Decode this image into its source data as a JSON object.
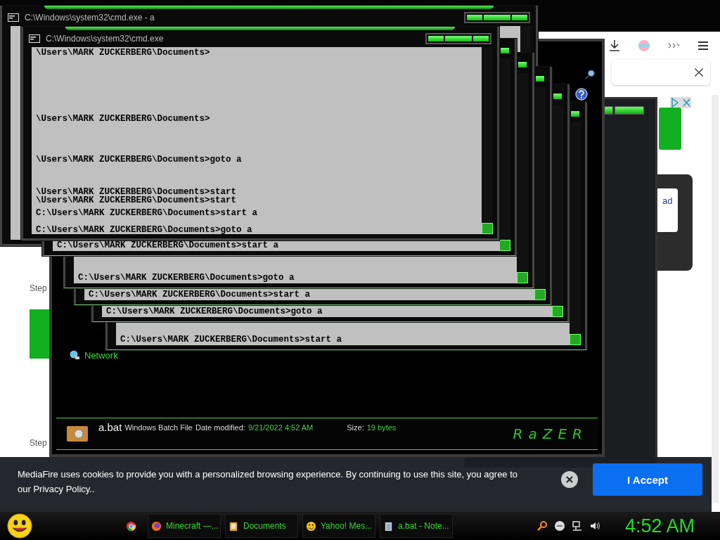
{
  "browser": {
    "ad_link": "ad",
    "steps": [
      "Step",
      "Step"
    ]
  },
  "explorer": {
    "nav_items": [
      {
        "label": "Network"
      }
    ],
    "details": {
      "name": "a.bat",
      "type": "Windows Batch File",
      "date_label": "Date modified:",
      "date": "9/21/2022 4:52 AM",
      "size_label": "Size:",
      "size": "19 bytes"
    },
    "logo": "RaZER"
  },
  "console_windows": [
    {
      "kind": "back",
      "title": "C:\\Windows\\system32\\cmd.exe - a"
    },
    {
      "kind": "strip",
      "lines": [
        "C:\\Users\\MARK ZUCKERBERG\\Documents>start a"
      ]
    },
    {
      "kind": "strip",
      "lines": [
        "C:\\Users\\MARK ZUCKERBERG\\Documents>goto a"
      ]
    },
    {
      "kind": "strip",
      "lines": [
        "C:\\Users\\MARK ZUCKERBERG\\Documents>start a"
      ]
    },
    {
      "kind": "strip",
      "lines": [
        "C:\\Users\\MARK ZUCKERBERG\\Documents>goto a"
      ]
    },
    {
      "kind": "strip",
      "lines": [
        "C:\\Users\\MARK ZUCKERBERG\\Documents>start a"
      ]
    },
    {
      "kind": "front",
      "title": "C:\\Windows\\system32\\cmd.exe",
      "lines": [
        "\\Users\\MARK ZUCKERBERG\\Documents>",
        "\\Users\\MARK ZUCKERBERG\\Documents>",
        "\\Users\\MARK ZUCKERBERG\\Documents>goto a",
        "\\Users\\MARK ZUCKERBERG\\Documents>start",
        "\\Users\\MARK ZUCKERBERG\\Documents>start",
        "C:\\Users\\MARK ZUCKERBERG\\Documents>start a",
        "C:\\Users\\MARK ZUCKERBERG\\Documents>goto a"
      ]
    }
  ],
  "cookie_banner": {
    "text": "MediaFire uses cookies to provide you with a personalized browsing experience. By continuing to use this site, you agree to our Privacy Policy..",
    "accept": "I Accept"
  },
  "taskbar": {
    "buttons": [
      {
        "kind": "browser",
        "label": "Minecraft —...",
        "selected": false
      },
      {
        "kind": "folder",
        "label": "Documents",
        "selected": false
      },
      {
        "kind": "messenger",
        "label": "Yahoo! Mes...",
        "selected": false
      },
      {
        "kind": "notepad",
        "label": "a.bat - Note...",
        "selected": false
      }
    ],
    "clock": "4:52 AM"
  }
}
